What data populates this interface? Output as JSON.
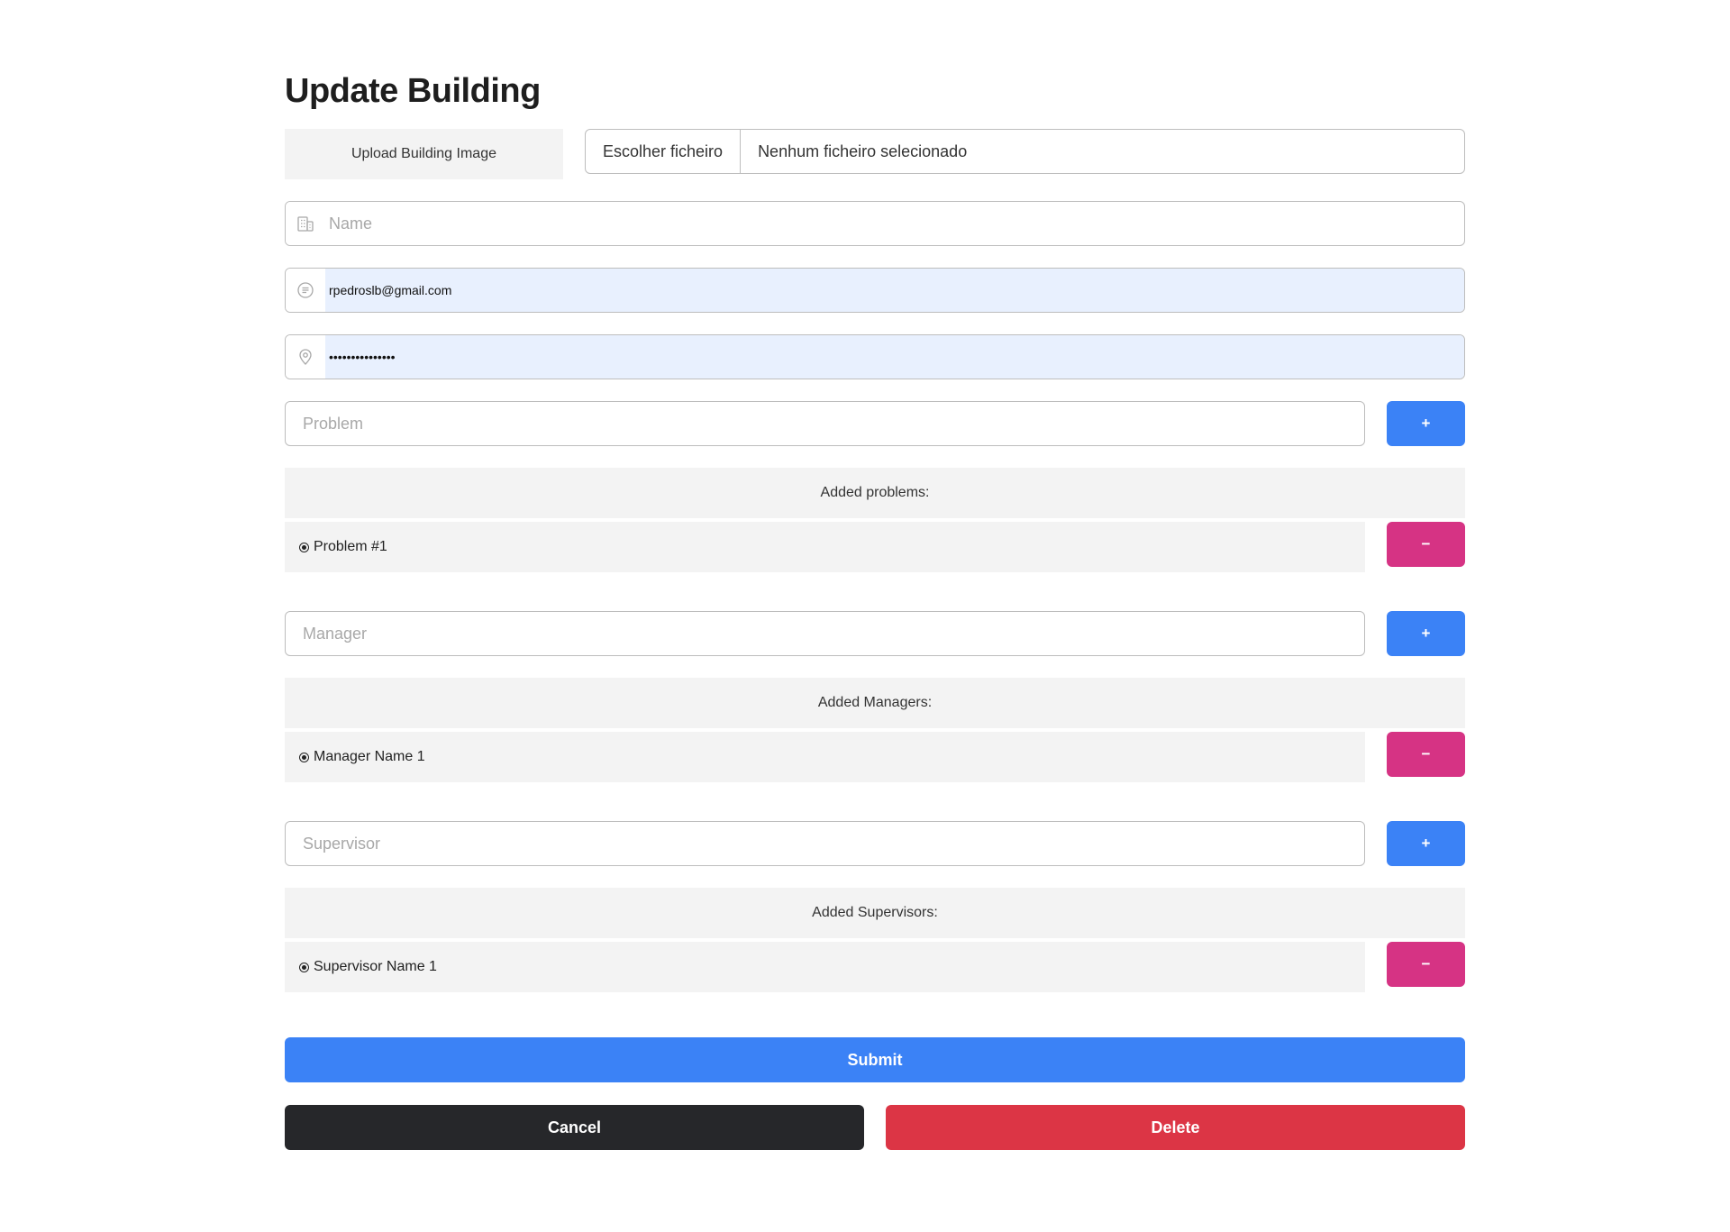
{
  "page": {
    "title": "Update Building"
  },
  "upload": {
    "label": "Upload Building Image",
    "choose_button": "Escolher ficheiro",
    "status": "Nenhum ficheiro selecionado"
  },
  "fields": {
    "name": {
      "placeholder": "Name",
      "value": "",
      "icon": "building-icon"
    },
    "email": {
      "value": "rpedroslb@gmail.com",
      "icon": "message-icon"
    },
    "location": {
      "value": "•••••••••••••••",
      "icon": "location-pin-icon"
    }
  },
  "problems": {
    "placeholder": "Problem",
    "add_label": "+",
    "header": "Added problems:",
    "items": [
      {
        "label": "Problem #1",
        "remove_label": "−"
      }
    ]
  },
  "managers": {
    "placeholder": "Manager",
    "add_label": "+",
    "header": "Added Managers:",
    "items": [
      {
        "label": "Manager Name 1",
        "remove_label": "−"
      }
    ]
  },
  "supervisors": {
    "placeholder": "Supervisor",
    "add_label": "+",
    "header": "Added Supervisors:",
    "items": [
      {
        "label": "Supervisor Name 1",
        "remove_label": "−"
      }
    ]
  },
  "actions": {
    "submit": "Submit",
    "cancel": "Cancel",
    "delete": "Delete"
  },
  "colors": {
    "primary": "#3b82f6",
    "remove": "#d63384",
    "danger": "#dc3545",
    "dark": "#26272a",
    "autofill": "#e8f0fe"
  }
}
